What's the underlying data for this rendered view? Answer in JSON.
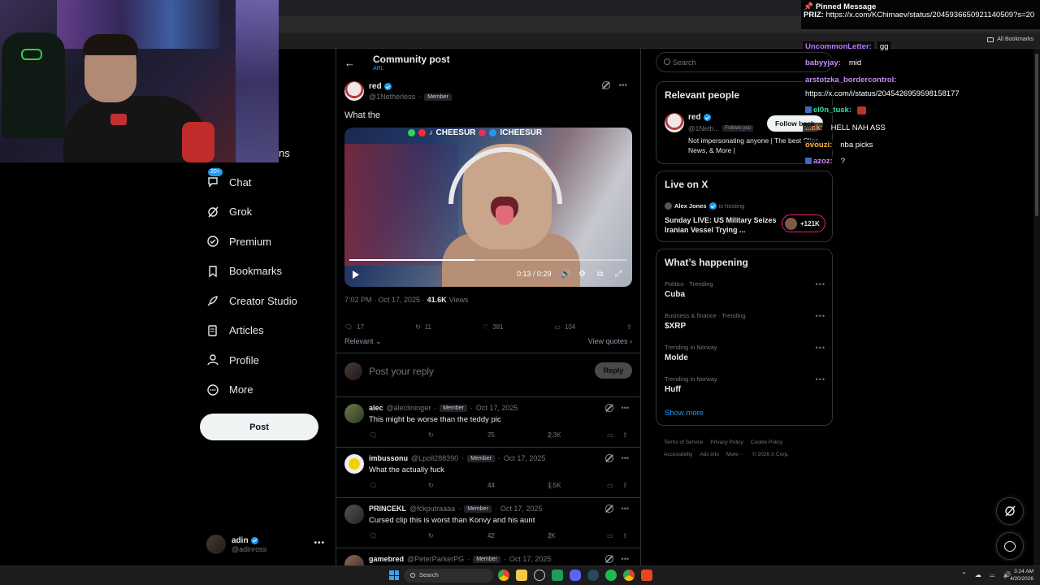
{
  "browser": {
    "bookmarks_label": "All Bookmarks"
  },
  "nav": {
    "partial_label": "ns",
    "chat_badge": "20+",
    "items": [
      {
        "label": "Chat"
      },
      {
        "label": "Grok"
      },
      {
        "label": "Premium"
      },
      {
        "label": "Bookmarks"
      },
      {
        "label": "Creator Studio"
      },
      {
        "label": "Articles"
      },
      {
        "label": "Profile"
      },
      {
        "label": "More"
      }
    ],
    "post_button": "Post",
    "account": {
      "name": "adin",
      "handle": "@adinross",
      "more": "•••"
    }
  },
  "main": {
    "title": "Community post",
    "subtitle": "ARL",
    "post": {
      "author": "red",
      "handle": "@1Netherless",
      "separator": "·",
      "tag": "Member",
      "text": "What the",
      "video": {
        "banner": "CHEESUR",
        "banner2": "ICHEESUR",
        "time": "0:13 / 0:29",
        "progress": 0.45
      },
      "timestamp": "7:02 PM · Oct 17, 2025 ·",
      "views_count": "41.6K",
      "views_label": "Views",
      "replies": "17",
      "reposts": "11",
      "likes": "381",
      "bookmarks": "104"
    },
    "sort_label": "Relevant",
    "view_quotes": "View quotes",
    "reply_placeholder": "Post your reply",
    "reply_button": "Reply",
    "replies": [
      {
        "name": "alec",
        "handle": "@aleclininger",
        "tag": "Member",
        "date": "Oct 17, 2025",
        "text": "This might be worse than the teddy pic",
        "likes": "75",
        "views": "2.3K"
      },
      {
        "name": "imbussonu",
        "handle": "@Lpoll288390",
        "tag": "Member",
        "date": "Oct 17, 2025",
        "text": "What the actually fuck",
        "likes": "44",
        "views": "1.5K"
      },
      {
        "name": "PRINCEKL",
        "handle": "@fckputraaaa",
        "tag": "Member",
        "date": "Oct 17, 2025",
        "text": "Cursed clip this is worst than Konvy and his aunt",
        "likes": "42",
        "views": "2K"
      },
      {
        "name": "gamebred",
        "handle": "@PeterParkerPG",
        "tag": "Member",
        "date": "Oct 17, 2025",
        "text": "",
        "likes": "",
        "views": ""
      }
    ]
  },
  "sidebar": {
    "search_placeholder": "Search",
    "relevant": {
      "title": "Relevant people",
      "name": "red",
      "handle": "@1Neth...",
      "follows_you": "Follows you",
      "follow_button": "Follow back",
      "bio": "Not impersonating anyone | The best Clips, News, & More |"
    },
    "live": {
      "title": "Live on X",
      "host": "Alex Jones",
      "hosting": "is hosting",
      "stream_title": "Sunday LIVE: US Military Seizes Iranian Vessel Trying ...",
      "listeners": "+121K"
    },
    "happening": {
      "title": "What’s happening",
      "trends": [
        {
          "category": "Politics · Trending",
          "topic": "Cuba"
        },
        {
          "category": "Business & finance · Trending",
          "topic": "$XRP"
        },
        {
          "category": "Trending in Norway",
          "topic": "Molde"
        },
        {
          "category": "Trending in Norway",
          "topic": "Huff"
        }
      ],
      "show_more": "Show more"
    },
    "footer": [
      "Terms of Service",
      "Privacy Policy",
      "Cookie Policy",
      "Accessibility",
      "Ads info",
      "More ···",
      "© 2026 X Corp."
    ]
  },
  "twitch_chat": {
    "pinned_title": "Pinned Message",
    "pinned_user": "PRIZ:",
    "pinned_text": "https://x.com/KChimaev/status/2045936650921140509?s=20",
    "messages": [
      {
        "user": "UncommonLetter:",
        "text": "gg",
        "color": "#b57bff",
        "badge": false
      },
      {
        "user": "babyyjay:",
        "text": "mid",
        "color": "#c88cff",
        "badge": false
      },
      {
        "user": "arstotzka_bordercontrol:",
        "text": "",
        "color": "#c78bff",
        "badge": false
      },
      {
        "user": "",
        "text": "https://x.com/i/status/2045426959598158177",
        "color": "#ffffff",
        "badge": false
      },
      {
        "user": "el0n_tusk:",
        "text": "",
        "color": "#33e0a8",
        "badge": true
      },
      {
        "user": "...ck:",
        "text": "HELL NAH ASS",
        "color": "#ff8a3d",
        "badge": false
      },
      {
        "user": "ovouzi:",
        "text": "nba picks",
        "color": "#ffb347",
        "badge": false
      },
      {
        "user": "azoz:",
        "text": "?",
        "color": "#d38bff",
        "badge": true
      }
    ]
  },
  "taskbar": {
    "search_label": "Search",
    "time": "3:24 AM",
    "date": "4/20/2026"
  }
}
